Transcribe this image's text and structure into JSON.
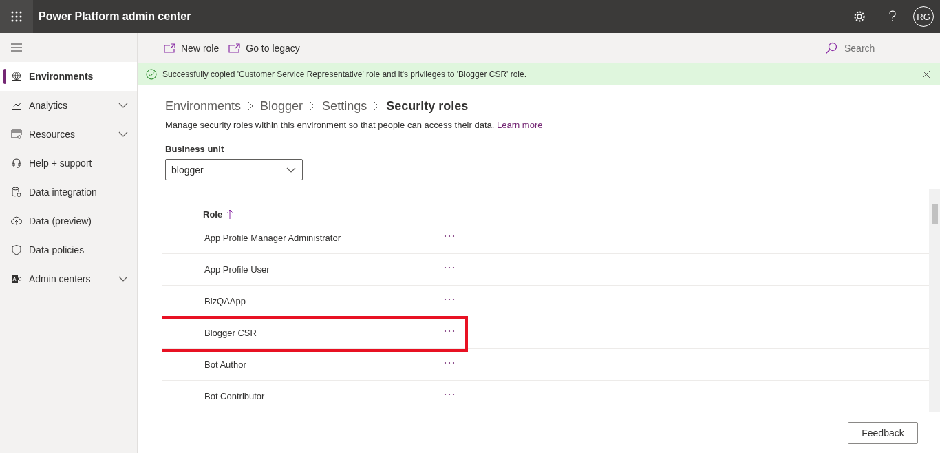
{
  "header": {
    "title": "Power Platform admin center",
    "avatar_initials": "RG"
  },
  "sidebar": {
    "items": [
      {
        "label": "Environments",
        "selected": true,
        "expandable": false
      },
      {
        "label": "Analytics",
        "selected": false,
        "expandable": true
      },
      {
        "label": "Resources",
        "selected": false,
        "expandable": true
      },
      {
        "label": "Help + support",
        "selected": false,
        "expandable": false
      },
      {
        "label": "Data integration",
        "selected": false,
        "expandable": false
      },
      {
        "label": "Data (preview)",
        "selected": false,
        "expandable": false
      },
      {
        "label": "Data policies",
        "selected": false,
        "expandable": false
      },
      {
        "label": "Admin centers",
        "selected": false,
        "expandable": true
      }
    ]
  },
  "command_bar": {
    "actions": [
      "New role",
      "Go to legacy"
    ],
    "search": {
      "placeholder": "Search"
    }
  },
  "notification": {
    "message": "Successfully copied 'Customer Service Representative' role and it's privileges to 'Blogger CSR' role."
  },
  "breadcrumb": [
    "Environments",
    "Blogger",
    "Settings",
    "Security roles"
  ],
  "description": {
    "text": "Manage security roles within this environment so that people can access their data.",
    "link": "Learn more"
  },
  "business_unit": {
    "label": "Business unit",
    "value": "blogger"
  },
  "table": {
    "columns": [
      {
        "label": "Role",
        "sorted_ascending": true
      }
    ],
    "rows": [
      {
        "role": "App Profile Manager Administrator",
        "highlighted": false
      },
      {
        "role": "App Profile User",
        "highlighted": false
      },
      {
        "role": "BizQAApp",
        "highlighted": false
      },
      {
        "role": "Blogger CSR",
        "highlighted": true
      },
      {
        "role": "Bot Author",
        "highlighted": false
      },
      {
        "role": "Bot Contributor",
        "highlighted": false
      }
    ]
  },
  "feedback_button": "Feedback"
}
